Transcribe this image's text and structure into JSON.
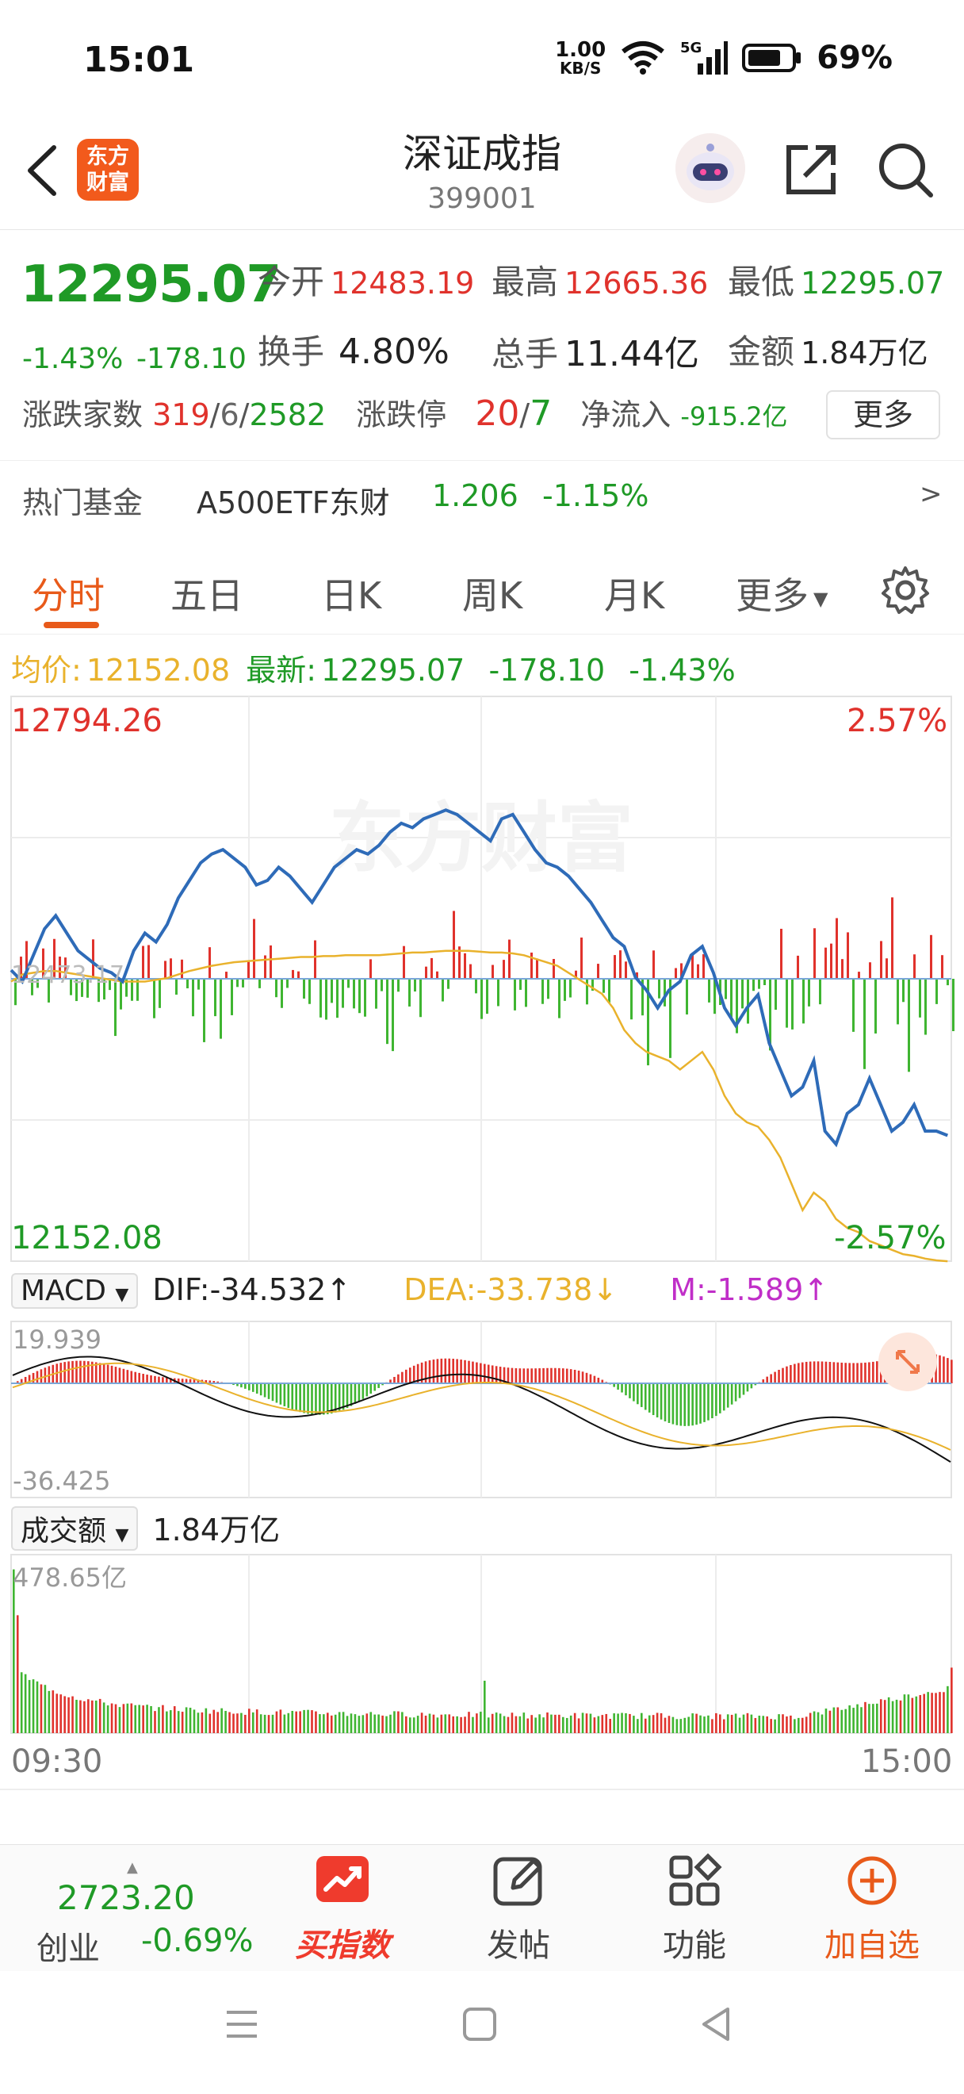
{
  "status": {
    "time": "15:01",
    "net_speed": "1.00",
    "net_unit": "KB/S",
    "signal": "5G",
    "battery": "69%"
  },
  "header": {
    "title": "深证成指",
    "code": "399001",
    "logo_text": "东方财富"
  },
  "quote": {
    "price": "12295.07",
    "pct": "-1.43%",
    "change": "-178.10",
    "open_label": "今开",
    "open": "12483.19",
    "high_label": "最高",
    "high": "12665.36",
    "low_label": "最低",
    "low": "12295.07",
    "turnover_label": "换手",
    "turnover": "4.80%",
    "volume_label": "总手",
    "volume": "11.44亿",
    "amount_label": "金额",
    "amount": "1.84万亿",
    "advdec_label": "涨跌家数",
    "adv": "319",
    "flat": "6",
    "dec": "2582",
    "limit_label": "涨跌停",
    "limit_up": "20",
    "limit_down": "7",
    "netflow_label": "净流入",
    "netflow": "-915.2亿",
    "more_label": "更多"
  },
  "fund": {
    "label": "热门基金",
    "name": "A500ETF东财",
    "price": "1.206",
    "pct": "-1.15%",
    "arrow": ">"
  },
  "tabs": [
    "分时",
    "五日",
    "日K",
    "周K",
    "月K",
    "更多"
  ],
  "avg": {
    "avg_label": "均价:",
    "avg_value": "12152.08",
    "latest_label": "最新:",
    "latest_value": "12295.07",
    "change": "-178.10",
    "pct": "-1.43%"
  },
  "price_chart": {
    "top_price": "12794.26",
    "top_pct": "2.57%",
    "bottom_price": "12152.08",
    "bottom_pct": "-2.57%",
    "mid_price": "12473.17",
    "watermark": "东方财富"
  },
  "macd": {
    "selector": "MACD",
    "dif": "DIF:-34.532↑",
    "dea": "DEA:-33.738↓",
    "m": "M:-1.589↑",
    "top": "19.939",
    "bottom": "-36.425"
  },
  "amount_chart": {
    "selector": "成交额",
    "total": "1.84万亿",
    "max": "478.65亿"
  },
  "time_axis": {
    "start": "09:30",
    "end": "15:00"
  },
  "bottom": {
    "index_value": "2723.20",
    "index_name": "创业",
    "index_pct": "-0.69%",
    "buy_label": "买指数",
    "post_label": "发帖",
    "func_label": "功能",
    "add_label": "加自选"
  },
  "chart_data": {
    "type": "line",
    "title": "",
    "price_series": [
      12483,
      12470,
      12500,
      12530,
      12545,
      12525,
      12505,
      12495,
      12485,
      12480,
      12470,
      12505,
      12525,
      12515,
      12535,
      12565,
      12585,
      12605,
      12615,
      12620,
      12610,
      12600,
      12580,
      12585,
      12600,
      12590,
      12575,
      12560,
      12580,
      12600,
      12610,
      12620,
      12615,
      12625,
      12640,
      12650,
      12645,
      12655,
      12660,
      12665,
      12660,
      12650,
      12640,
      12630,
      12655,
      12660,
      12640,
      12620,
      12605,
      12600,
      12590,
      12575,
      12560,
      12540,
      12520,
      12510,
      12475,
      12460,
      12440,
      12460,
      12470,
      12500,
      12510,
      12480,
      12440,
      12420,
      12440,
      12455,
      12400,
      12370,
      12340,
      12350,
      12380,
      12300,
      12285,
      12320,
      12330,
      12360,
      12330,
      12300,
      12310,
      12330,
      12300,
      12300,
      12295
    ],
    "avg_series": [
      12470,
      12478,
      12480,
      12482,
      12482,
      12480,
      12478,
      12476,
      12474,
      12472,
      12470,
      12470,
      12470,
      12472,
      12474,
      12478,
      12482,
      12485,
      12488,
      12490,
      12492,
      12493,
      12494,
      12495,
      12496,
      12497,
      12498,
      12498,
      12499,
      12499,
      12500,
      12500,
      12500,
      12500,
      12501,
      12502,
      12503,
      12503,
      12504,
      12505,
      12505,
      12505,
      12504,
      12503,
      12503,
      12502,
      12500,
      12496,
      12492,
      12488,
      12480,
      12472,
      12464,
      12456,
      12440,
      12415,
      12400,
      12390,
      12385,
      12380,
      12370,
      12380,
      12390,
      12370,
      12340,
      12320,
      12310,
      12305,
      12290,
      12270,
      12240,
      12210,
      12230,
      12220,
      12200,
      12190,
      12185,
      12175,
      12170,
      12165,
      12160,
      12158,
      12155,
      12153,
      12152
    ],
    "ylim": [
      12152.08,
      12794.26
    ]
  }
}
